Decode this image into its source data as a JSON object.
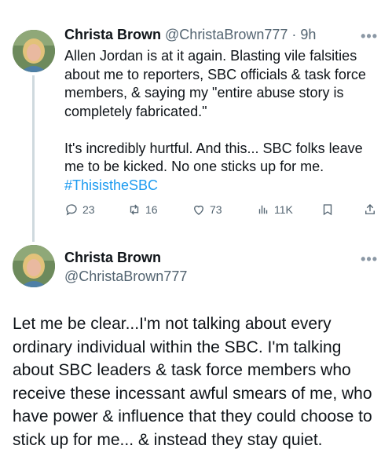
{
  "tweet1": {
    "name": "Christa Brown",
    "handle": "@ChristaBrown777",
    "time": "· 9h",
    "more": "•••",
    "body1": "Allen Jordan is at it again. Blasting vile falsities about me to reporters, SBC officials & task force members, & saying my \"entire abuse story is completely fabricated.\"",
    "body2": "It's incredibly hurtful. And this... SBC folks leave me to be kicked. No one sticks up for me.",
    "hashtag": "#ThisistheSBC",
    "replies": "23",
    "retweets": "16",
    "likes": "73",
    "views": "11K"
  },
  "tweet2": {
    "name": "Christa Brown",
    "handle": "@ChristaBrown777",
    "more": "•••",
    "body": "Let me be clear...I'm not talking about every ordinary individual within the SBC. I'm talking about SBC leaders & task force members who receive these incessant awful smears of me, who have power & influence that they could choose to stick up for me... & instead they stay quiet."
  },
  "colors": {
    "accent": "#1d9bf0",
    "secondary_text": "#536471",
    "thread_line": "#cfd9de"
  }
}
